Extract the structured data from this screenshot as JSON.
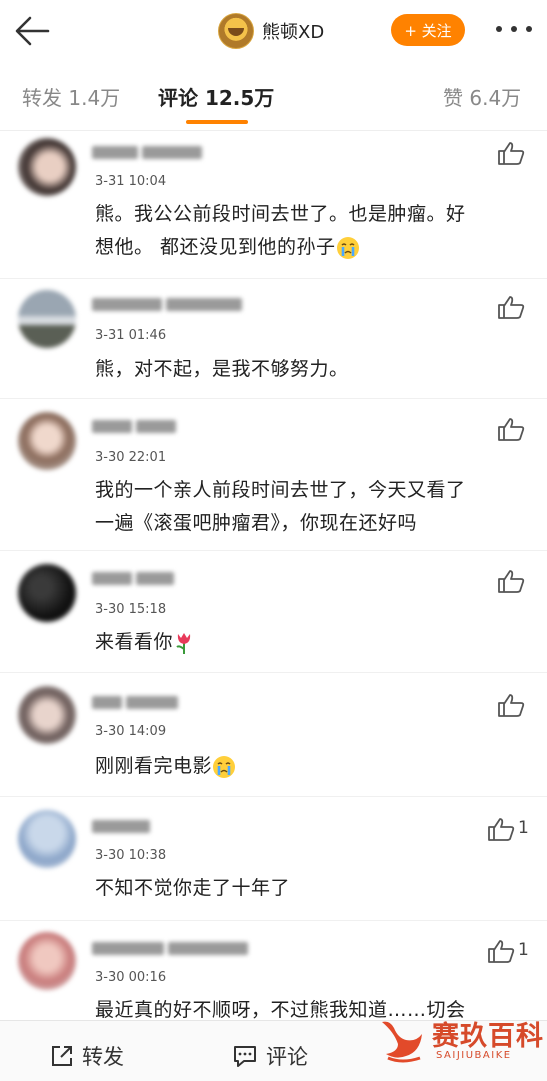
{
  "header": {
    "author_name": "熊顿XD",
    "follow_label": "+ 关注"
  },
  "tabs": {
    "repost": "转发 1.4万",
    "comments": "评论 12.5万",
    "likes": "赞 6.4万"
  },
  "comments": [
    {
      "time": "3-31 10:04",
      "text_line1": "熊。我公公前段时间去世了。也是肿瘤。好",
      "text_line2": "想他。 都还没见到他的孙子",
      "emoji": "crying-emoji",
      "likes": ""
    },
    {
      "time": "3-31 01:46",
      "text_line1": "熊，对不起，是我不够努力。",
      "likes": ""
    },
    {
      "time": "3-30 22:01",
      "text_line1": "我的一个亲人前段时间去世了，今天又看了",
      "text_line2": "一遍《滚蛋吧肿瘤君》，你现在还好吗",
      "likes": ""
    },
    {
      "time": "3-30 15:18",
      "text_line1": "来看看你",
      "emoji": "tulip-emoji",
      "likes": ""
    },
    {
      "time": "3-30 14:09",
      "text_line1": "刚刚看完电影",
      "emoji": "crying-emoji",
      "likes": ""
    },
    {
      "time": "3-30 10:38",
      "text_line1": "不知不觉你走了十年了",
      "likes": "1"
    },
    {
      "time": "3-30 00:16",
      "text_line1": "最近真的好不顺呀，不过熊我知道……切会",
      "likes": "1"
    }
  ],
  "bottom_bar": {
    "repost_label": "转发",
    "comment_label": "评论"
  },
  "watermark": {
    "brand_cn": "赛玖百科",
    "brand_en": "SAIJIUBAIKE"
  },
  "colors": {
    "accent": "#ff8200",
    "watermark": "#d64a2a"
  }
}
